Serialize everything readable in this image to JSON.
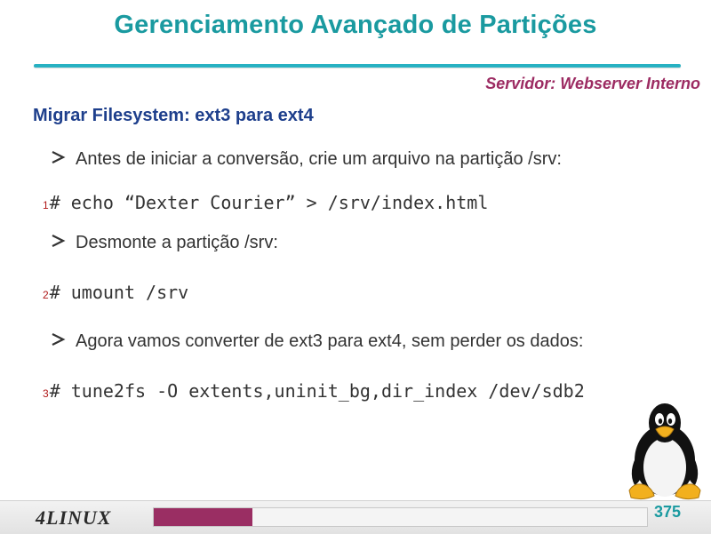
{
  "slide": {
    "title": "Gerenciamento Avançado de Partições",
    "server": "Servidor: Webserver Interno",
    "section": "Migrar Filesystem:  ext3 para ext4"
  },
  "bullets": [
    "Antes de iniciar a conversão, crie um arquivo na partição /srv:",
    "Desmonte a partição /srv:",
    "Agora vamos converter de ext3  para ext4, sem perder os dados:"
  ],
  "commands": [
    {
      "num": "1",
      "text": "# echo “Dexter Courier” > /srv/index.html"
    },
    {
      "num": "2",
      "text": "# umount /srv"
    },
    {
      "num": "3",
      "text": "# tune2fs -O extents,uninit_bg,dir_index /dev/sdb2"
    }
  ],
  "footer": {
    "logo": "4LINUX",
    "page_number": "375",
    "progress_fraction": 0.2
  },
  "colors": {
    "title": "#1a9aa0",
    "server": "#9c2b62",
    "section": "#1e3f8c",
    "progress": "#9a2e63"
  },
  "icons": {
    "bullet": "arrow-bullet-icon",
    "mascot": "tux-penguin-icon"
  }
}
